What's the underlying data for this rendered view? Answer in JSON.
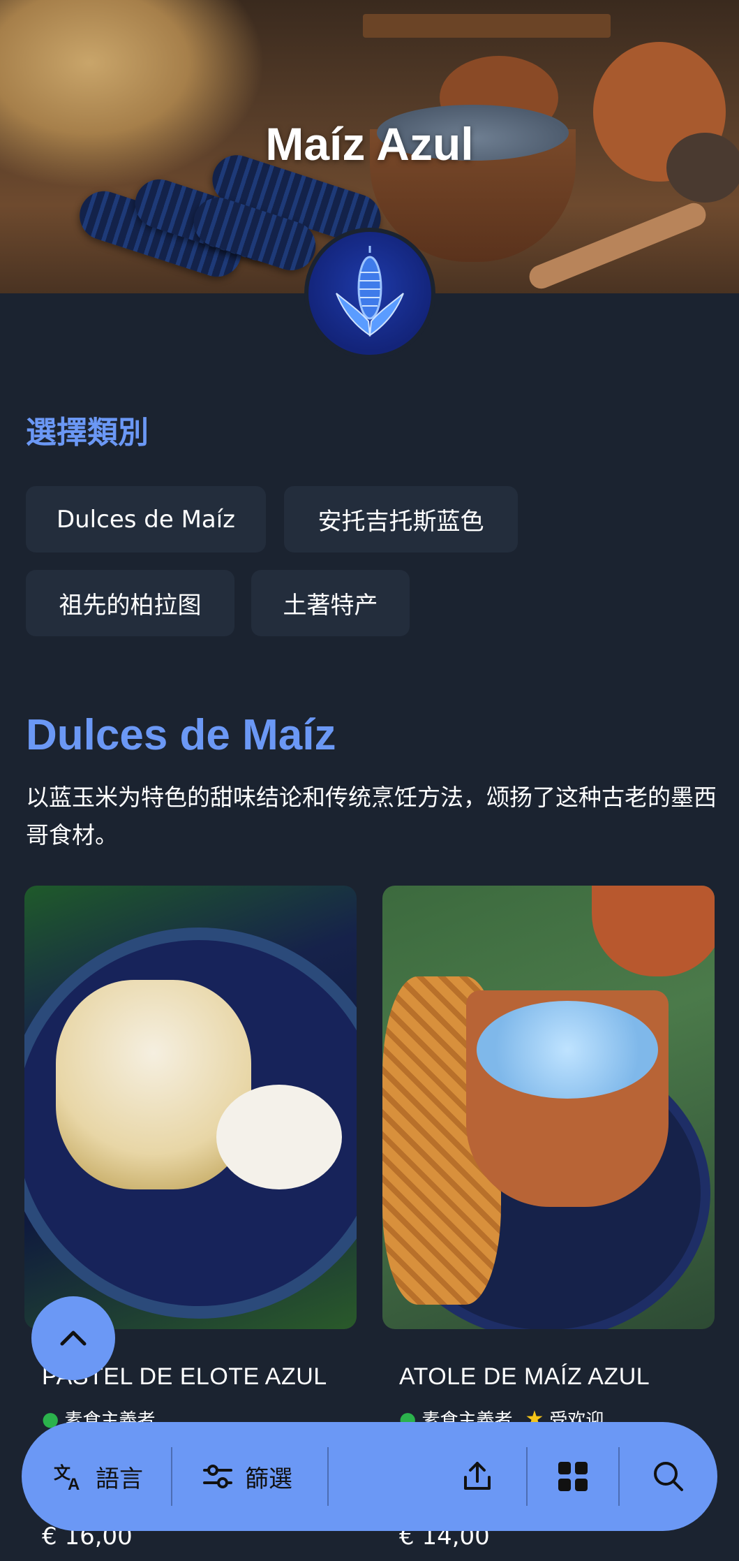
{
  "hero": {
    "title": "Maíz Azul"
  },
  "category_section": {
    "heading": "選擇類別",
    "chips": [
      "Dulces de Maíz",
      "安托吉托斯蓝色",
      "祖先的柏拉图",
      "土著特产"
    ]
  },
  "section": {
    "title": "Dulces de Maíz",
    "description": "以蓝玉米为特色的甜味结论和传统烹饪方法，颂扬了这种古老的墨西哥食材。"
  },
  "cards": [
    {
      "name": "PASTEL DE ELOTE AZUL",
      "tags": [
        "素食主義者"
      ],
      "price": "€ 16,00"
    },
    {
      "name": "ATOLE DE MAÍZ AZUL",
      "tags": [
        "素食主義者",
        "受欢迎"
      ],
      "price": "€ 14,00"
    }
  ],
  "bottom_bar": {
    "language_label": "語言",
    "filter_label": "篩選"
  },
  "colors": {
    "accent": "#6b98f5",
    "background": "#1b2330",
    "chip": "#232d3c"
  }
}
